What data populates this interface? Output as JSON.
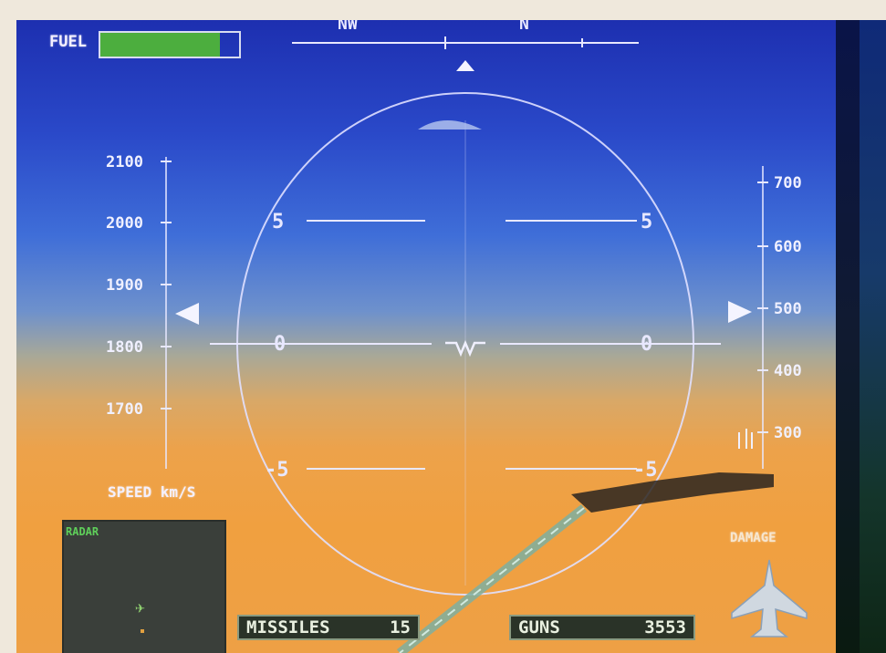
{
  "heading": {
    "labels": [
      "NW",
      "N"
    ]
  },
  "fuel": {
    "label": "FUEL",
    "level_percent": 86
  },
  "speed_scale": {
    "ticks": [
      "2100",
      "2000",
      "1900",
      "1800",
      "1700"
    ],
    "unit_label": "SPEED km/S"
  },
  "alt_scale": {
    "ticks": [
      "700",
      "600",
      "500",
      "400",
      "300"
    ]
  },
  "pitch_ladder": {
    "upper": "5",
    "center": "0",
    "lower": "-5"
  },
  "radar": {
    "label": "RADAR"
  },
  "weapons": {
    "missiles_label": "MISSILES",
    "missiles_count": "15",
    "guns_label": "GUNS",
    "guns_count": "3553"
  },
  "damage": {
    "label": "DAMAGE"
  },
  "colors": {
    "hud_line": "#e8e8ff",
    "fuel_green": "#4cae3e"
  }
}
